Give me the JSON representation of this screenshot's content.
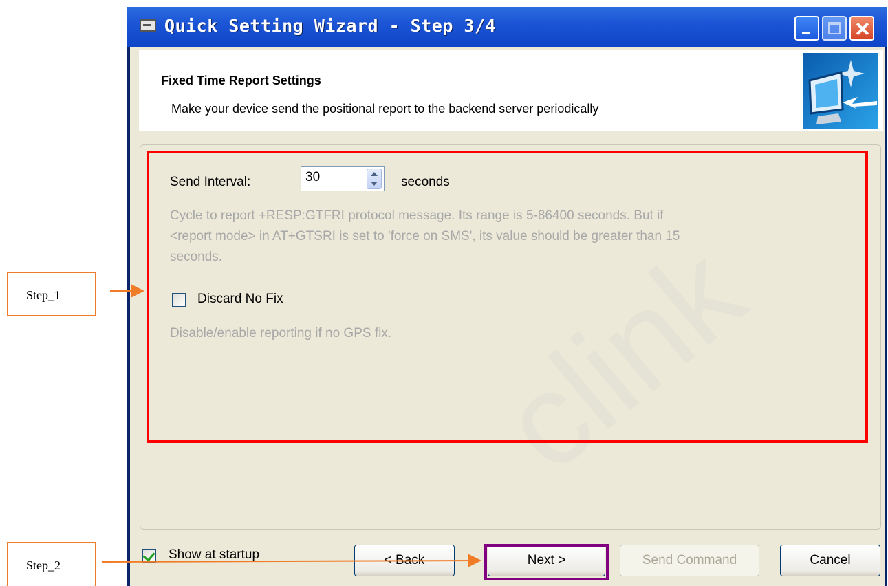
{
  "window": {
    "title": "Quick Setting Wizard - Step 3/4"
  },
  "header": {
    "title": "Fixed Time Report Settings",
    "description": "Make your device send the positional report to the backend server periodically"
  },
  "settings": {
    "send_interval_label": "Send Interval:",
    "send_interval_value": "30",
    "send_interval_unit": "seconds",
    "send_interval_help_1": "Cycle to report +RESP:GTFRI protocol message. Its range is 5-86400 seconds. But if",
    "send_interval_help_2": "<report mode> in AT+GTSRI is set to 'force on SMS', its value should be greater than 15",
    "send_interval_help_3": "seconds.",
    "discard_no_fix_label": "Discard No Fix",
    "discard_no_fix_checked": false,
    "discard_no_fix_help": "Disable/enable reporting if no GPS fix."
  },
  "footer": {
    "show_at_startup_label": "Show at startup",
    "show_at_startup_checked": true,
    "back_label": "< Back",
    "next_label": "Next >",
    "send_command_label": "Send Command",
    "cancel_label": "Cancel"
  },
  "annotations": {
    "step1": "Step_1",
    "step2": "Step_2",
    "highlight_color": "#ff0000",
    "next_highlight_color": "#800080",
    "arrow_color": "#f07c28"
  },
  "watermark": "clink",
  "icons": {
    "window_icon": "window-icon",
    "header_icon": "monitor-arrow-icon"
  }
}
